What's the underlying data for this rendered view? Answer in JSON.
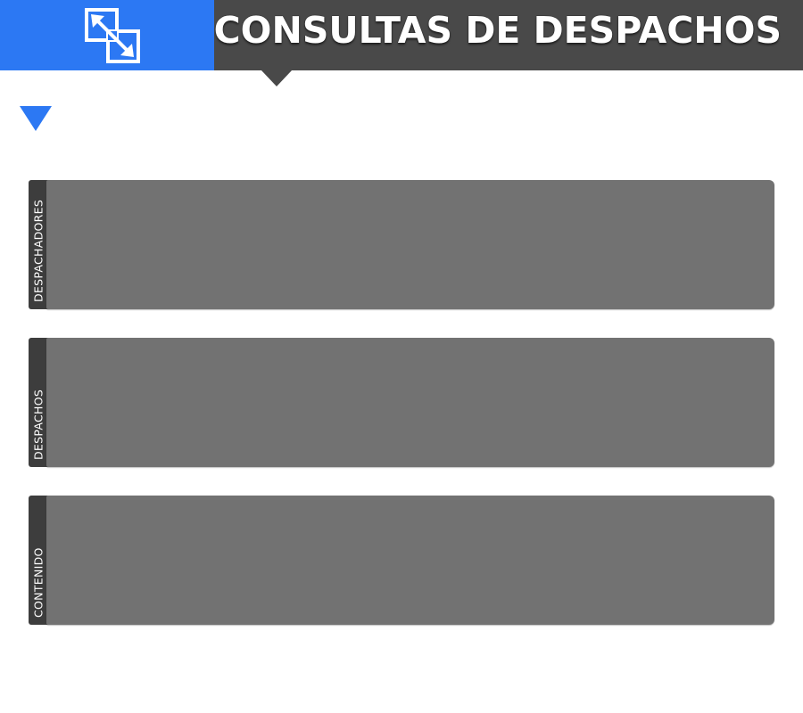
{
  "header": {
    "title": "CONSULTAS DE DESPACHOS",
    "logo_icon": "expand-arrows-icon"
  },
  "colors": {
    "accent": "#2c78f3",
    "header_dark": "#494949",
    "panel_body": "#727272",
    "panel_tab": "#3d3d3d"
  },
  "panels": [
    {
      "label": "DESPACHADORES"
    },
    {
      "label": "DESPACHOS"
    },
    {
      "label": "CONTENIDO"
    }
  ]
}
